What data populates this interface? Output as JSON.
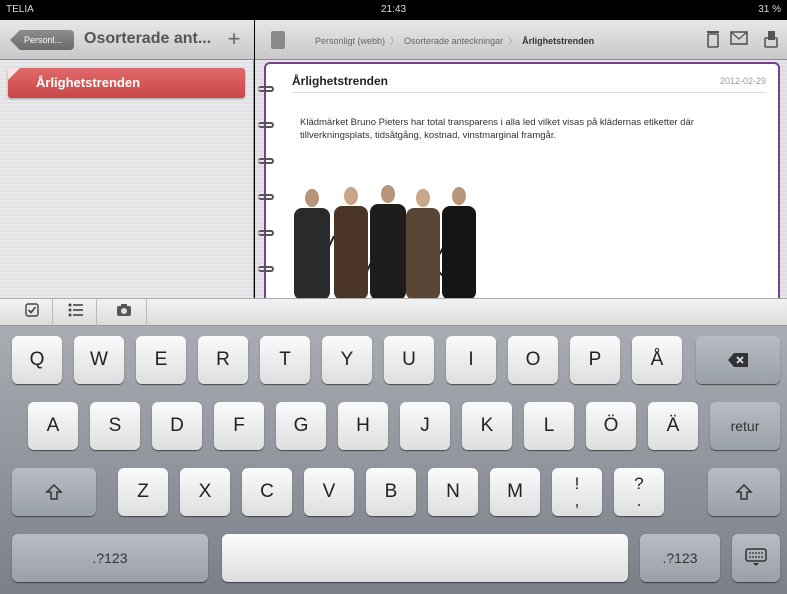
{
  "status_bar": {
    "carrier": "TELIA",
    "time": "21:43",
    "battery": "31 %"
  },
  "left_pane": {
    "back_label": "Personl...",
    "title": "Osorterade ant...",
    "add_icon": "plus-icon",
    "notes": [
      {
        "label": "Årlighetstrenden"
      }
    ]
  },
  "right_pane": {
    "breadcrumb": [
      "Personligt (webb)",
      "Osorterade anteckningar",
      "Årlighetstrenden"
    ],
    "toolbar_icons": [
      "trash-icon",
      "mail-icon",
      "share-icon"
    ],
    "note": {
      "title": "Årlighetstrenden",
      "date": "2012-02-29",
      "body": "Klädmärket Bruno Pieters har total transparens i alla led vilket visas på klädernas etiketter där tillverkningsplats, tidsåtgång, kostnad, vinstmarginal framgår."
    }
  },
  "accessory_bar": {
    "icons": [
      "checkbox-icon",
      "list-icon",
      "camera-icon"
    ]
  },
  "keyboard": {
    "row1": [
      "Q",
      "W",
      "E",
      "R",
      "T",
      "Y",
      "U",
      "I",
      "O",
      "P",
      "Å"
    ],
    "row2": [
      "A",
      "S",
      "D",
      "F",
      "G",
      "H",
      "J",
      "K",
      "L",
      "Ö",
      "Ä"
    ],
    "row3": [
      "Z",
      "X",
      "C",
      "V",
      "B",
      "N",
      "M"
    ],
    "punct1_top": "!",
    "punct1_bottom": ",",
    "punct2_top": "?",
    "punct2_bottom": ".",
    "return_label": "retur",
    "numbers_label": ".?123",
    "backspace_icon": "backspace-icon",
    "shift_icon": "shift-icon",
    "hide_icon": "keyboard-hide-icon"
  },
  "colors": {
    "accent": "#d25656",
    "page_border": "#7a3f8a"
  }
}
